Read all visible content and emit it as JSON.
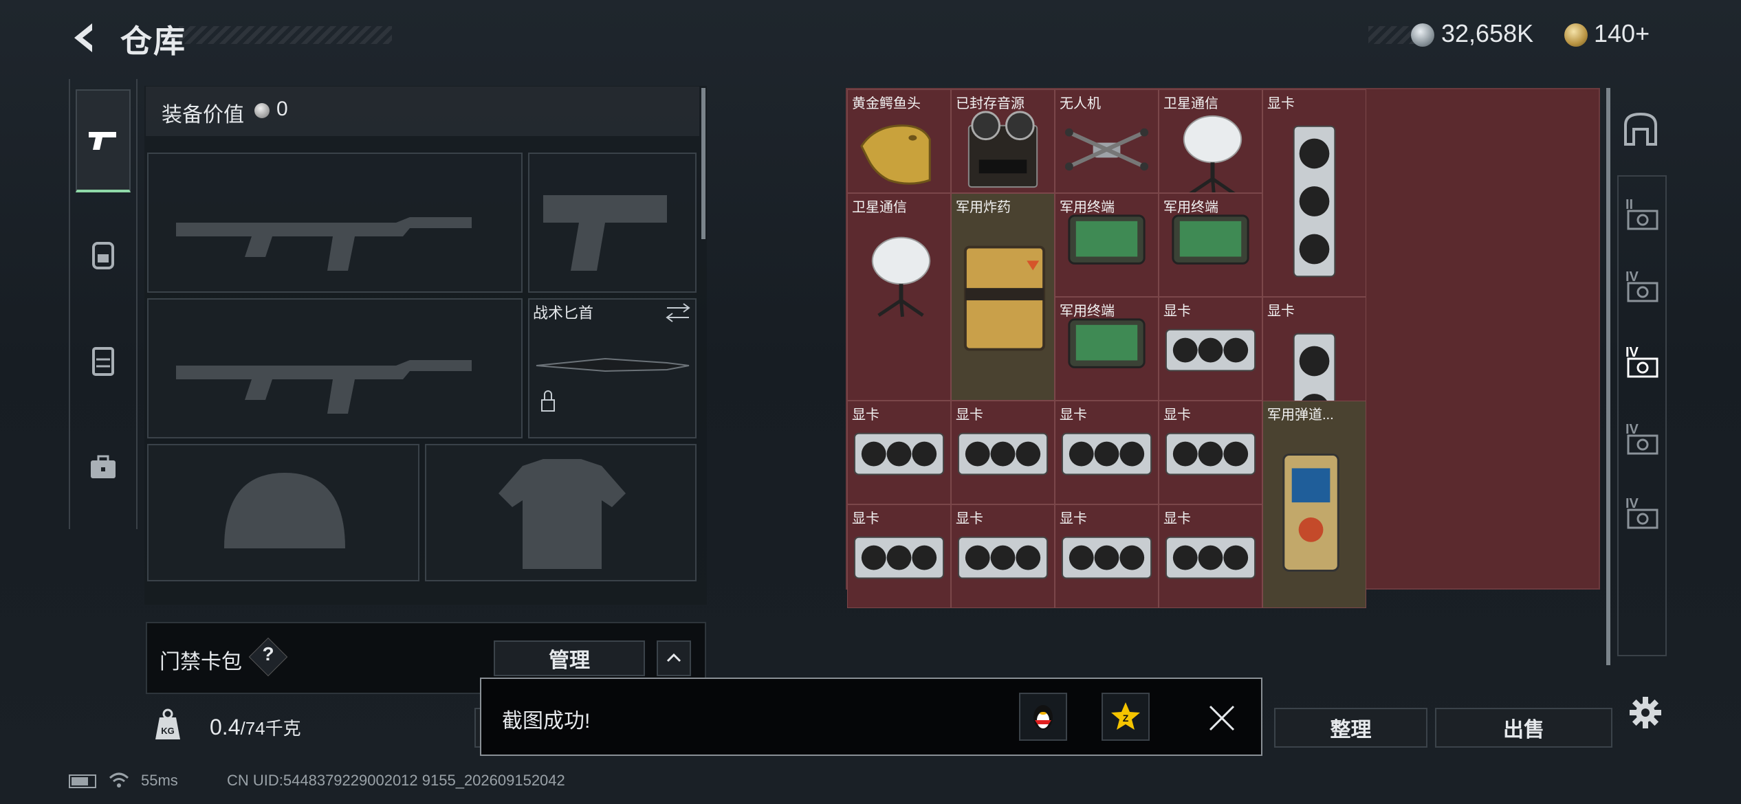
{
  "header": {
    "title": "仓库",
    "currency_silver": "32,658K",
    "currency_gold": "140+"
  },
  "equipment": {
    "value_label": "装备价值",
    "value": "0",
    "knife_label": "战术匕首"
  },
  "card_pack": {
    "label": "门禁卡包",
    "help": "?",
    "manage": "管理"
  },
  "weight": {
    "current": "0.4",
    "max": "/74千克",
    "icon_text": "KG"
  },
  "stash_items": [
    {
      "label": "黄金鳄鱼头",
      "icon": "gold-croc-head-icon"
    },
    {
      "label": "已封存音源",
      "icon": "reel-tape-recorder-icon"
    },
    {
      "label": "无人机",
      "icon": "drone-icon"
    },
    {
      "label": "卫星通信",
      "icon": "satellite-dish-icon"
    },
    {
      "label": "显卡",
      "icon": "graphics-card-icon"
    },
    {
      "label": "卫星通信",
      "icon": "satellite-dish-icon"
    },
    {
      "label": "军用炸药",
      "icon": "explosive-crate-icon"
    },
    {
      "label": "军用终端",
      "icon": "military-terminal-icon"
    },
    {
      "label": "军用终端",
      "icon": "military-terminal-icon"
    },
    {
      "label": "显卡",
      "icon": "graphics-card-icon"
    },
    {
      "label": "军用终端",
      "icon": "military-terminal-icon"
    },
    {
      "label": "显卡",
      "icon": "graphics-card-icon"
    },
    {
      "label": "显卡",
      "icon": "graphics-card-icon"
    },
    {
      "label": "显卡",
      "icon": "graphics-card-icon"
    },
    {
      "label": "显卡",
      "icon": "graphics-card-icon"
    },
    {
      "label": "显卡",
      "icon": "graphics-card-icon"
    },
    {
      "label": "军用弹道...",
      "icon": "ballistic-computer-icon"
    },
    {
      "label": "显卡",
      "icon": "graphics-card-icon"
    },
    {
      "label": "显卡",
      "icon": "graphics-card-icon"
    },
    {
      "label": "显卡",
      "icon": "graphics-card-icon"
    },
    {
      "label": "显卡",
      "icon": "graphics-card-icon"
    }
  ],
  "tiers": [
    "II",
    "IV",
    "IV",
    "IV",
    "IV"
  ],
  "actions": {
    "sort": "整理",
    "sell": "出售"
  },
  "toast": {
    "message": "截图成功!"
  },
  "footer": {
    "ping": "55ms",
    "uid": "CN UID:5448379229002012 9155_202609152042"
  },
  "colors": {
    "stash_bg": "#5c2a2f",
    "accent_tab": "#8fd9a8"
  }
}
